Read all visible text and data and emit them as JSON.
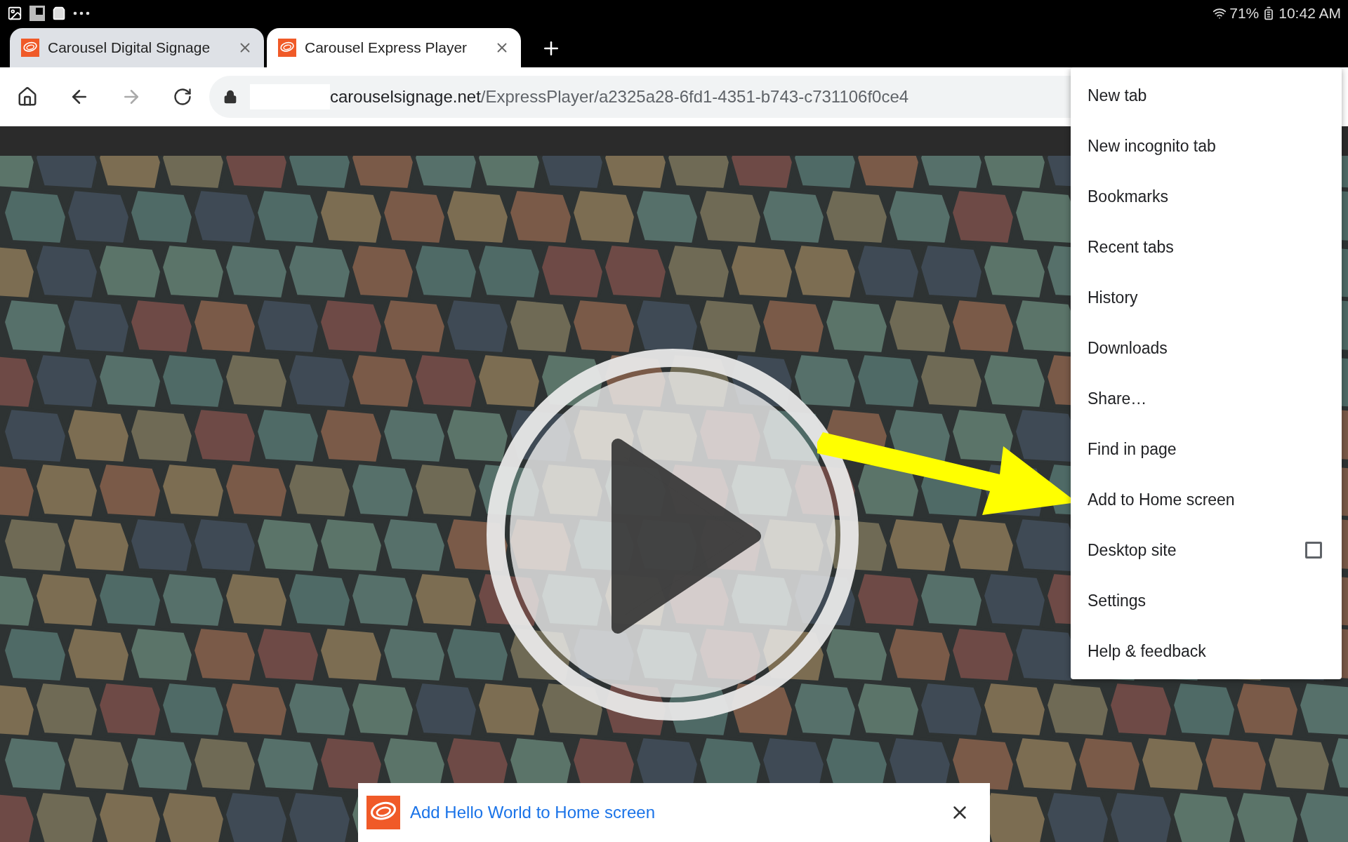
{
  "status_bar": {
    "battery": "71%",
    "time": "10:42 AM"
  },
  "tabs": [
    {
      "title": "Carousel Digital Signage",
      "selected": false
    },
    {
      "title": "Carousel Express Player",
      "selected": true
    }
  ],
  "address_bar": {
    "domain": "carouselsignage.net",
    "path": "/ExpressPlayer/a2325a28-6fd1-4351-b743-c731106f0ce4"
  },
  "menu": {
    "items": [
      {
        "kind": "plain",
        "label": "New tab"
      },
      {
        "kind": "plain",
        "label": "New incognito tab"
      },
      {
        "kind": "plain",
        "label": "Bookmarks"
      },
      {
        "kind": "plain",
        "label": "Recent tabs"
      },
      {
        "kind": "plain",
        "label": "History"
      },
      {
        "kind": "plain",
        "label": "Downloads"
      },
      {
        "kind": "plain",
        "label": "Share…"
      },
      {
        "kind": "plain",
        "label": "Find in page"
      },
      {
        "kind": "plain",
        "label": "Add to Home screen"
      },
      {
        "kind": "checkbox",
        "label": "Desktop site",
        "checked": false
      },
      {
        "kind": "plain",
        "label": "Settings"
      },
      {
        "kind": "plain",
        "label": "Help & feedback"
      }
    ]
  },
  "install_banner": {
    "text": "Add Hello World to Home screen"
  }
}
